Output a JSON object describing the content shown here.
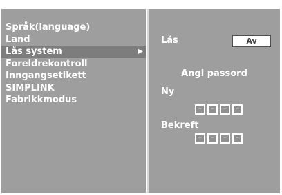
{
  "menu": {
    "items": [
      {
        "label": "Språk(language)"
      },
      {
        "label": "Land"
      },
      {
        "label": "Lås system",
        "arrow": "▶"
      },
      {
        "label": "Foreldrekontroll"
      },
      {
        "label": "Inngangsetikett"
      },
      {
        "label": "SIMPLINK"
      },
      {
        "label": "Fabrikkmodus"
      }
    ],
    "selected_index": 2
  },
  "lock": {
    "label": "Lås",
    "value": "Av"
  },
  "password": {
    "title": "Angi passord",
    "new_label": "Ny",
    "new_pin": [
      "–",
      "–",
      "–",
      "–"
    ],
    "confirm_label": "Bekreft",
    "confirm_pin": [
      "–",
      "–",
      "–",
      "–"
    ]
  },
  "colors": {
    "panel": "#9e9e9e",
    "selected": "#7d7d7d",
    "text": "#ffffff"
  }
}
